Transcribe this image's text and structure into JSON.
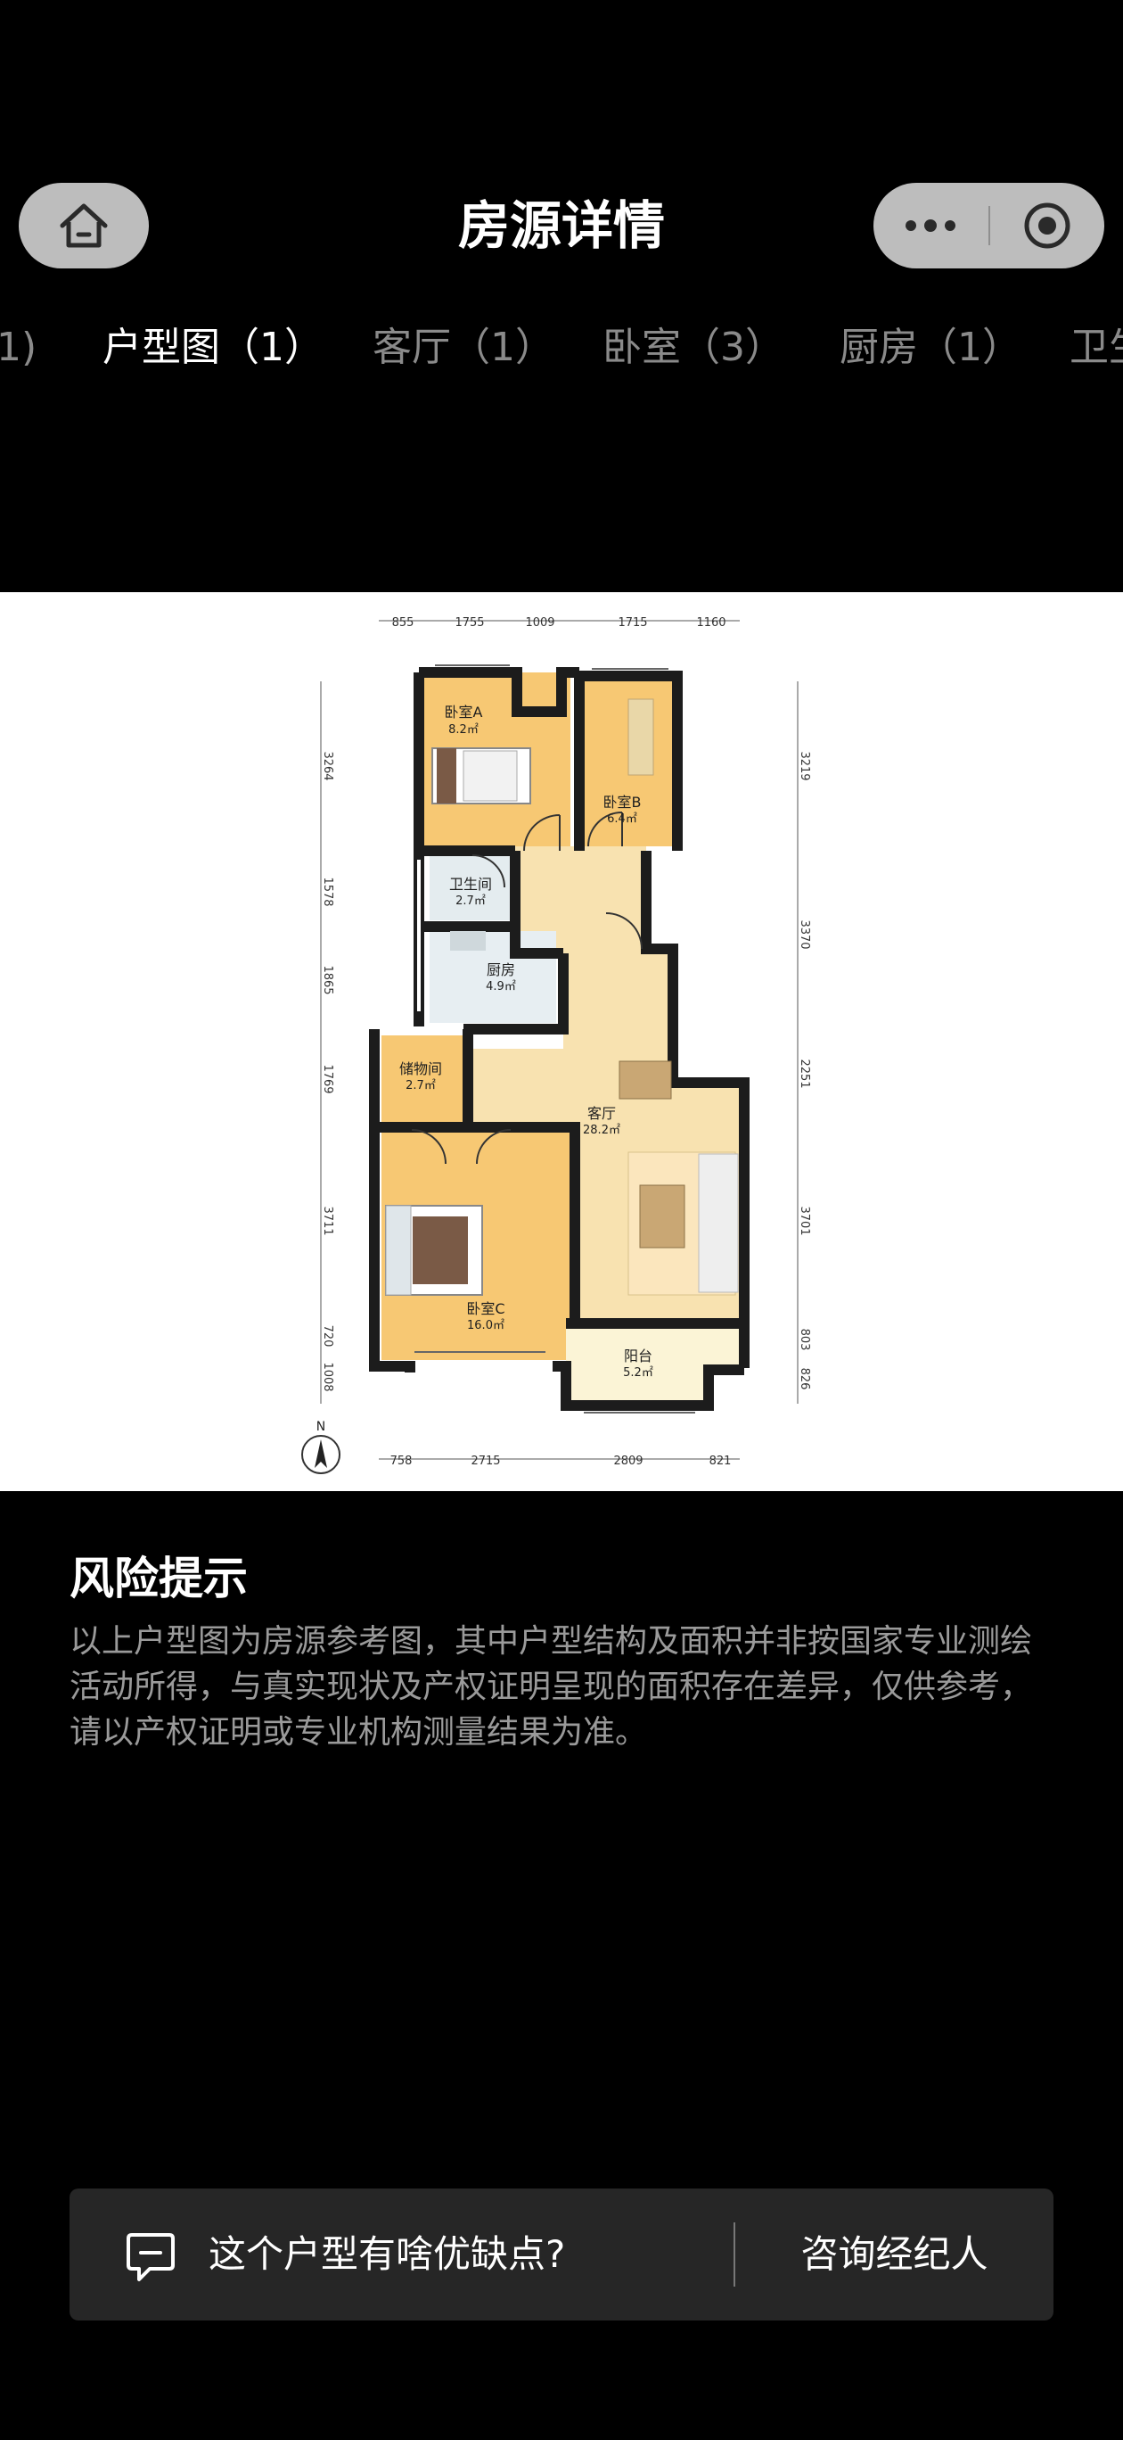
{
  "header": {
    "title": "房源详情"
  },
  "tabs": [
    {
      "label": "1)"
    },
    {
      "label": "户型图（1）"
    },
    {
      "label": "客厅（1）"
    },
    {
      "label": "卧室（3）"
    },
    {
      "label": "厨房（1）"
    },
    {
      "label": "卫生"
    }
  ],
  "floorplan": {
    "rooms": [
      {
        "name": "卧室A",
        "area": "8.2㎡"
      },
      {
        "name": "卧室B",
        "area": "6.4㎡"
      },
      {
        "name": "卫生间",
        "area": "2.7㎡"
      },
      {
        "name": "厨房",
        "area": "4.9㎡"
      },
      {
        "name": "储物间",
        "area": "2.7㎡"
      },
      {
        "name": "客厅",
        "area": "28.2㎡"
      },
      {
        "name": "卧室C",
        "area": "16.0㎡"
      },
      {
        "name": "阳台",
        "area": "5.2㎡"
      }
    ],
    "dims_top": [
      "855",
      "1755",
      "1009",
      "1715",
      "1160"
    ],
    "dims_bottom": [
      "758",
      "2715",
      "2809",
      "821"
    ],
    "dims_left": [
      "3264",
      "1578",
      "1865",
      "1769",
      "3711",
      "720",
      "1008"
    ],
    "dims_right": [
      "3219",
      "3370",
      "2251",
      "3701",
      "803",
      "826"
    ],
    "compass": "N"
  },
  "risk": {
    "title": "风险提示",
    "text": "以上户型图为房源参考图，其中户型结构及面积并非按国家专业测绘活动所得，与真实现状及产权证明呈现的面积存在差异，仅供参考，请以产权证明或专业机构测量结果为准。"
  },
  "bottom": {
    "ask": "这个户型有啥优缺点?",
    "consult": "咨询经纪人"
  },
  "colors": {
    "background": "#000000",
    "capsule": "#bdbdbd",
    "room_fill": "#f7c873",
    "living_fill": "#f8e2b0",
    "bar": "#262626"
  }
}
